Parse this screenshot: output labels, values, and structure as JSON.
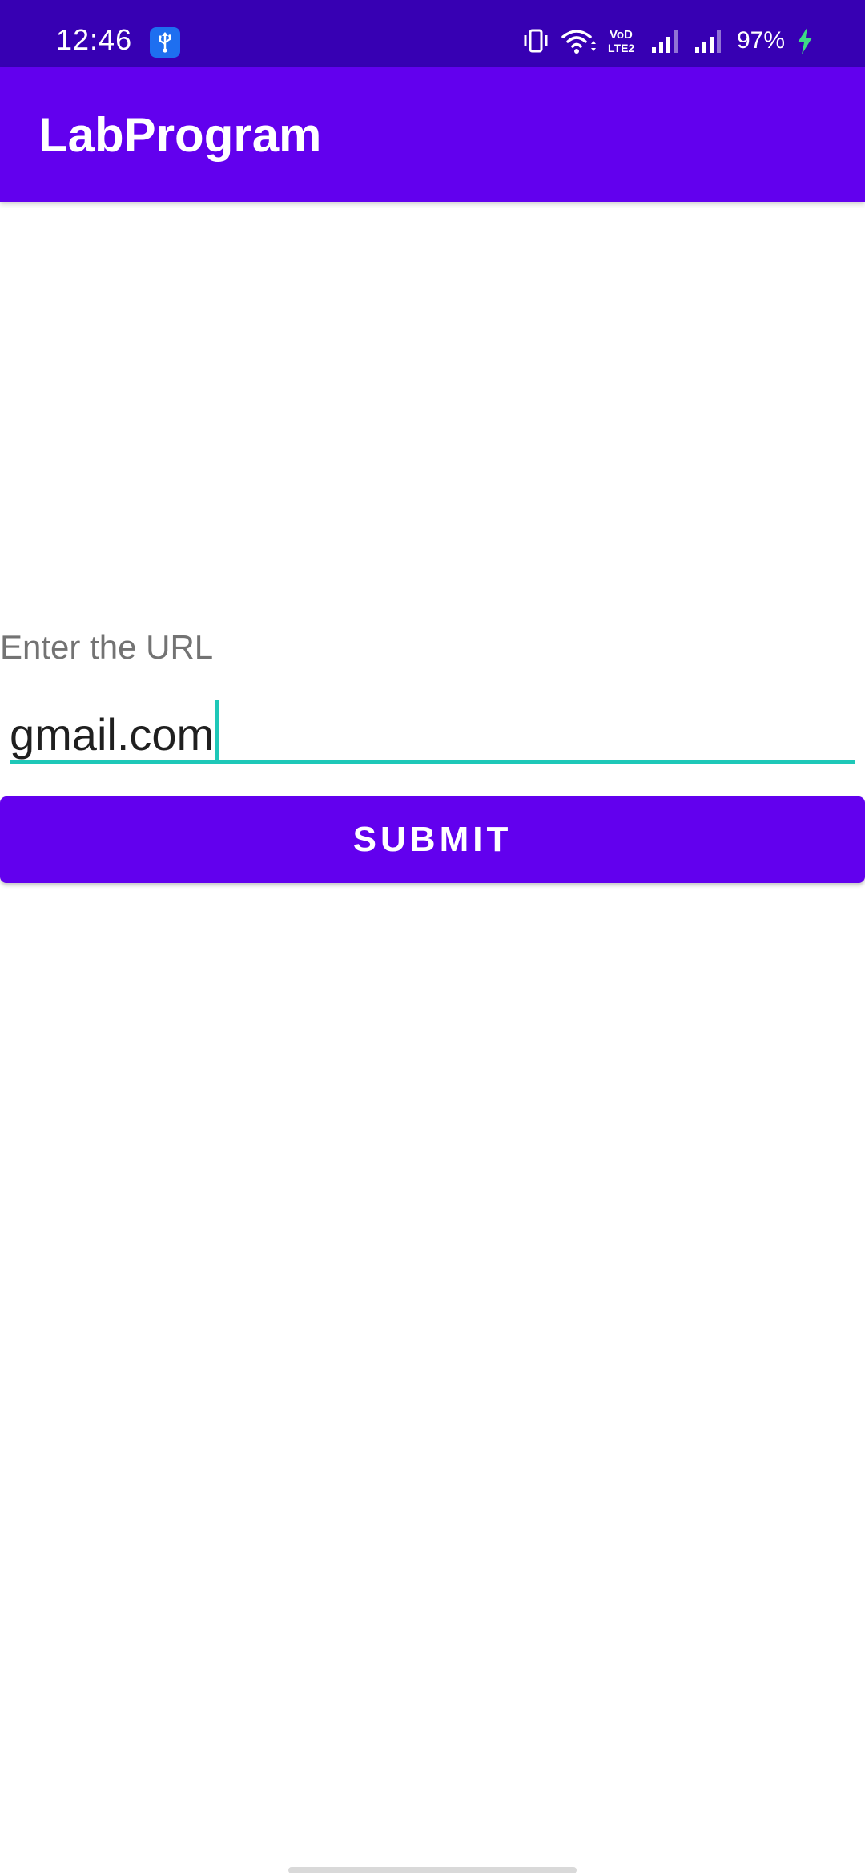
{
  "status_bar": {
    "time": "12:46",
    "battery_percent": "97%",
    "colors": {
      "background": "#3700b3",
      "usb_badge": "#1e6ff0",
      "charging_bolt": "#3ddc84"
    },
    "icons": [
      "usb-icon",
      "vibrate-icon",
      "wifi-icon",
      "volte-icon",
      "signal-icon",
      "signal-icon",
      "charging-bolt-icon"
    ],
    "volte_text": "Vo LTE 2"
  },
  "app_bar": {
    "title": "LabProgram",
    "background": "#6200ee"
  },
  "form": {
    "url_label": "Enter the URL",
    "url_value": "gmail.com",
    "accent_color": "#1ec8b8",
    "submit_label": "SUBMIT",
    "submit_color": "#6200ee"
  }
}
